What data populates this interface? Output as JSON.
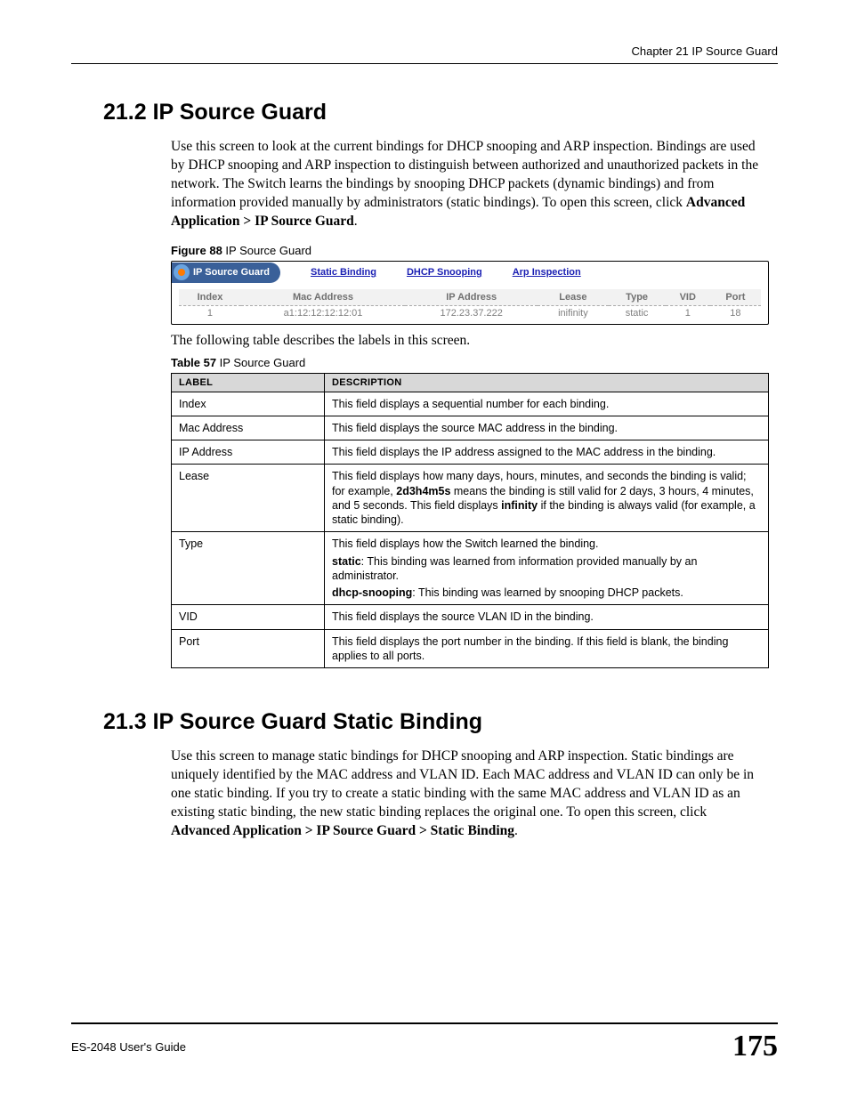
{
  "runningHeader": "Chapter 21 IP Source Guard",
  "section212": {
    "heading": "21.2  IP Source Guard",
    "para_before": "Use this screen to look at the current bindings for DHCP snooping and ARP inspection. Bindings are used by DHCP snooping and ARP inspection to distinguish between authorized and unauthorized packets in the network. The Switch learns the bindings by snooping DHCP packets (dynamic bindings) and from information provided manually by administrators (static bindings). To open this screen, click ",
    "para_bold": "Advanced Application > IP Source Guard",
    "para_after": "."
  },
  "figure88": {
    "caption_bold": "Figure 88",
    "caption_rest": "   IP Source Guard",
    "chip_label": "IP Source Guard",
    "links": [
      "Static Binding",
      "DHCP Snooping",
      "Arp Inspection"
    ],
    "headers": [
      "Index",
      "Mac Address",
      "IP Address",
      "Lease",
      "Type",
      "VID",
      "Port"
    ],
    "row": [
      "1",
      "a1:12:12:12:12:01",
      "172.23.37.222",
      "inifinity",
      "static",
      "1",
      "18"
    ]
  },
  "tbl57_intro": "The following table describes the labels in this screen.",
  "table57": {
    "caption_bold": "Table 57",
    "caption_rest": "   IP Source Guard",
    "header_label": "LABEL",
    "header_desc": "DESCRIPTION",
    "rows": [
      {
        "label": "Index",
        "desc_plain": "This field displays a sequential number for each binding."
      },
      {
        "label": "Mac Address",
        "desc_plain": "This field displays the source MAC address in the binding."
      },
      {
        "label": "IP Address",
        "desc_plain": "This field displays the IP address assigned to the MAC address in the binding."
      },
      {
        "label": "Lease",
        "segments": [
          {
            "t": "This field displays how many days, hours, minutes, and seconds the binding is valid; for example, "
          },
          {
            "t": "2d3h4m5s",
            "b": true
          },
          {
            "t": " means the binding is still valid for 2 days, 3 hours, 4 minutes, and 5 seconds. This field displays "
          },
          {
            "t": "infinity",
            "b": true
          },
          {
            "t": " if the binding is always valid (for example, a static binding)."
          }
        ]
      },
      {
        "label": "Type",
        "segments": [
          {
            "t": "This field displays how the Switch learned the binding."
          },
          {
            "br": true
          },
          {
            "t": "static",
            "b": true
          },
          {
            "t": ": This binding was learned from information provided manually by an administrator."
          },
          {
            "br": true
          },
          {
            "t": "dhcp-snooping",
            "b": true
          },
          {
            "t": ": This binding was learned by snooping DHCP packets."
          }
        ]
      },
      {
        "label": "VID",
        "desc_plain": "This field displays the source VLAN ID in the binding."
      },
      {
        "label": "Port",
        "desc_plain": "This field displays the port number in the binding. If this field is blank, the binding applies to all ports."
      }
    ]
  },
  "section213": {
    "heading": "21.3  IP Source Guard Static Binding",
    "para_before": "Use this screen to manage static bindings for DHCP snooping and ARP inspection. Static bindings are uniquely identified by the MAC address and VLAN ID. Each MAC address and VLAN ID can only be in one static binding. If you try to create a static binding with the same MAC address and VLAN ID as an existing static binding, the new static binding replaces the original one. To open this screen, click ",
    "para_bold": "Advanced Application > IP Source Guard > Static Binding",
    "para_after": "."
  },
  "footer": {
    "guide": "ES-2048 User's Guide",
    "page": "175"
  }
}
